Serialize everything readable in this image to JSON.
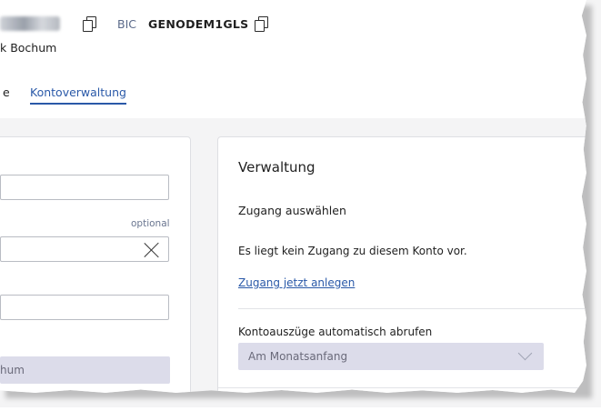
{
  "header": {
    "bic_label": "BIC",
    "bic_value": "GENODEM1GLS",
    "bank_name": "k Bochum"
  },
  "tabs": {
    "previous_partial": "e",
    "active": "Kontoverwaltung"
  },
  "left_form": {
    "optional_label": "optional",
    "frequency_value_partial": "hum"
  },
  "verwaltung": {
    "title": "Verwaltung",
    "access_heading": "Zugang auswählen",
    "no_access_text": "Es liegt kein Zugang zu diesem Konto vor.",
    "create_link": "Zugang jetzt anlegen",
    "auto_fetch_label": "Kontoauszüge automatisch abrufen",
    "auto_fetch_value": "Am Monatsanfang"
  },
  "icons": {
    "copy": "copy-icon",
    "clear": "close-icon",
    "dropdown": "chevron-down-icon"
  },
  "colors": {
    "link": "#2a59a8",
    "disabled_fill": "#dcdcea",
    "bic_label": "#5b6a8a"
  }
}
